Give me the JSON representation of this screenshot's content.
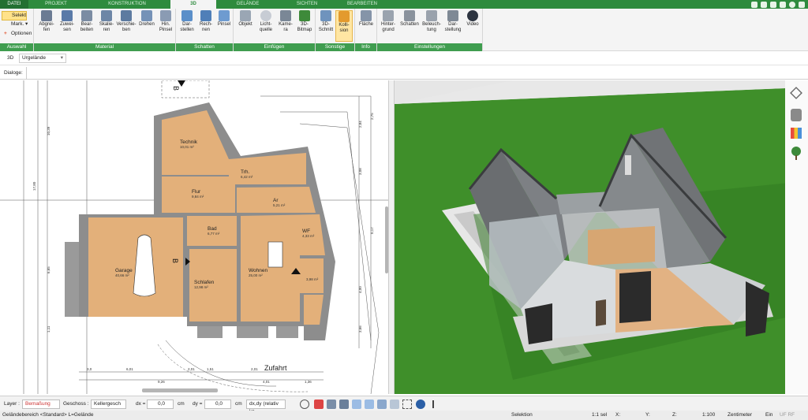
{
  "tabs": [
    "DATEI",
    "PROJEKT",
    "KONSTRUKTION",
    "3D",
    "GELÄNDE",
    "SICHTEN",
    "BEARBEITEN"
  ],
  "ribbon": {
    "selekt": "Selekt",
    "mark": "Mark.",
    "optionen": "Optionen",
    "groups": {
      "auswahl": "Auswahl",
      "material": "Material",
      "schatten": "Schatten",
      "einfuegen": "Einfügen",
      "sonstige": "Sonstige",
      "info": "Info",
      "einstellungen": "Einstellungen"
    },
    "buttons": {
      "abgreifen": "Abgrei-\nfen",
      "zuweisen": "Zuwei-\nsen",
      "bearbeiten": "Bear-\nbeiten",
      "skalieren": "Skalie-\nren",
      "verschieben": "Verschie-\nben",
      "drehen": "Drehen",
      "hinpinsel": "Hin.\nPinsel",
      "darstellen": "Dar-\nstellen",
      "rechnen": "Rech-\nnen",
      "pinsel": "Pinsel",
      "objekt": "Objekt",
      "lichtquelle": "Licht-\nquelle",
      "kamera": "Kame-\nra",
      "bitmap": "3D-\nBitmap",
      "schnitt": "3D-\nSchnitt",
      "kollision": "Kolli-\nsion",
      "flaeche": "Fläche",
      "hintergrund": "Hinter-\ngrund",
      "schatten": "Schatten",
      "beleuchtung": "Beleuch-\ntung",
      "darstellung": "Dar-\nstellung",
      "video": "Video"
    }
  },
  "toolbar2": {
    "mode": "3D",
    "selection": "Urgelände"
  },
  "dialoge": "Dialoge:",
  "plan": {
    "rooms": [
      {
        "name": "Technik",
        "area": "10,01 m²"
      },
      {
        "name": "Trh.",
        "area": "6,42 m²"
      },
      {
        "name": "Flur",
        "area": "9,84 m²"
      },
      {
        "name": "Ar",
        "area": "5,21 m²"
      },
      {
        "name": "Bad",
        "area": "6,77 m²"
      },
      {
        "name": "WF",
        "area": "4,33 m²"
      },
      {
        "name": "Garage",
        "area": "40,66 m²"
      },
      {
        "name": "Wohnen",
        "area": "25,00 m²"
      },
      {
        "name": "Schlafen",
        "area": "12,98 m²"
      },
      {
        "name": "",
        "area": "3,98 m²"
      }
    ],
    "street": "Zufahrt",
    "section_marker": "B",
    "dims_left": [
      "10,39",
      "17,80",
      "6,65",
      "1,11"
    ],
    "dims_right": [
      "2,84",
      "2,75",
      "3,08",
      "4,00",
      "0,17",
      "3,66"
    ],
    "dims_bottom": [
      "6,01",
      "9,26",
      "2,01",
      "1,51",
      "2,01",
      "4,01",
      "1,36",
      "3,0"
    ]
  },
  "bottombar": {
    "layer_label": "Layer :",
    "layer_value": "Bemaßung",
    "geschoss_label": "Geschoss :",
    "geschoss_value": "Kellergesch",
    "dx_label": "dx =",
    "dx_value": "0,0",
    "dx_unit": "cm",
    "dy_label": "dy =",
    "dy_value": "0,0",
    "dy_unit": "cm",
    "mode_value": "dx,dy (relativ kz"
  },
  "status": {
    "left": "Geländebereich <Standard> L=Gelände",
    "selektion": "Selektion",
    "sel": "1:1 sel",
    "x": "X:",
    "y": "Y:",
    "z": "Z:",
    "scale": "1:100",
    "unit": "Zentimeter",
    "ein": "Ein",
    "flags": "UF  RF"
  },
  "colors": {
    "brand": "#2e8b3e",
    "floor": "#e3b07a",
    "wall": "#8a8a8a",
    "grass": "#3f8f2a",
    "roof": "#5f6163"
  }
}
